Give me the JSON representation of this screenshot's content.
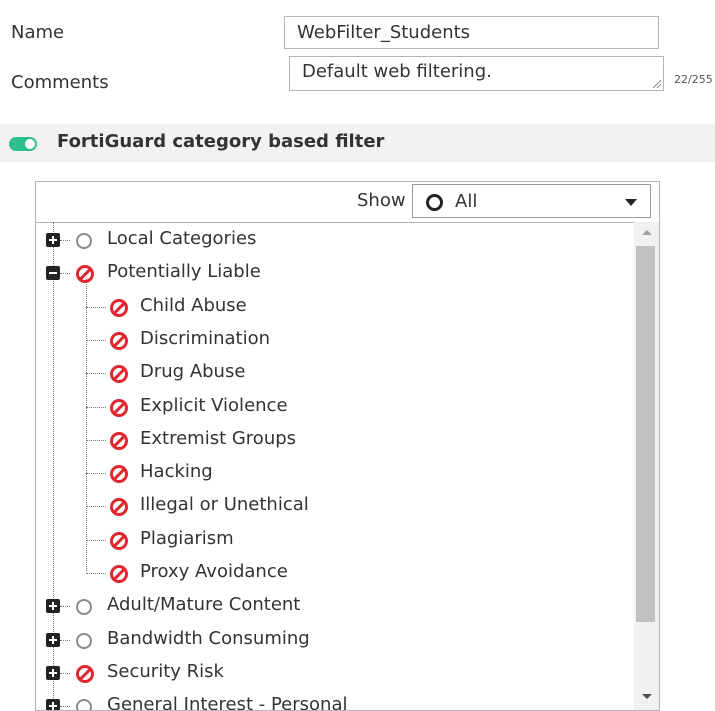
{
  "form": {
    "name_label": "Name",
    "name_value": "WebFilter_Students",
    "comments_label": "Comments",
    "comments_value": "Default web filtering.",
    "comments_counter": "22/255"
  },
  "filter": {
    "title": "FortiGuard category based filter",
    "enabled": true,
    "toggle_color": "#2fbf8f"
  },
  "panel": {
    "show_label": "Show",
    "show_selected": "All",
    "show_icon": "circle-outline-icon"
  },
  "categories": [
    {
      "label": "Local Categories",
      "level": 0,
      "expander": "plus",
      "status": "none"
    },
    {
      "label": "Potentially Liable",
      "level": 0,
      "expander": "minus",
      "status": "block"
    },
    {
      "label": "Child Abuse",
      "level": 1,
      "status": "block"
    },
    {
      "label": "Discrimination",
      "level": 1,
      "status": "block"
    },
    {
      "label": "Drug Abuse",
      "level": 1,
      "status": "block"
    },
    {
      "label": "Explicit Violence",
      "level": 1,
      "status": "block"
    },
    {
      "label": "Extremist Groups",
      "level": 1,
      "status": "block"
    },
    {
      "label": "Hacking",
      "level": 1,
      "status": "block"
    },
    {
      "label": "Illegal or Unethical",
      "level": 1,
      "status": "block"
    },
    {
      "label": "Plagiarism",
      "level": 1,
      "status": "block"
    },
    {
      "label": "Proxy Avoidance",
      "level": 1,
      "status": "block"
    },
    {
      "label": "Adult/Mature Content",
      "level": 0,
      "expander": "plus",
      "status": "none"
    },
    {
      "label": "Bandwidth Consuming",
      "level": 0,
      "expander": "plus",
      "status": "none"
    },
    {
      "label": "Security Risk",
      "level": 0,
      "expander": "plus",
      "status": "block"
    },
    {
      "label": "General Interest - Personal",
      "level": 0,
      "expander": "plus",
      "status": "none"
    }
  ],
  "colors": {
    "block": "#e0262e",
    "none": "#8a8a8a",
    "text": "#333333"
  }
}
